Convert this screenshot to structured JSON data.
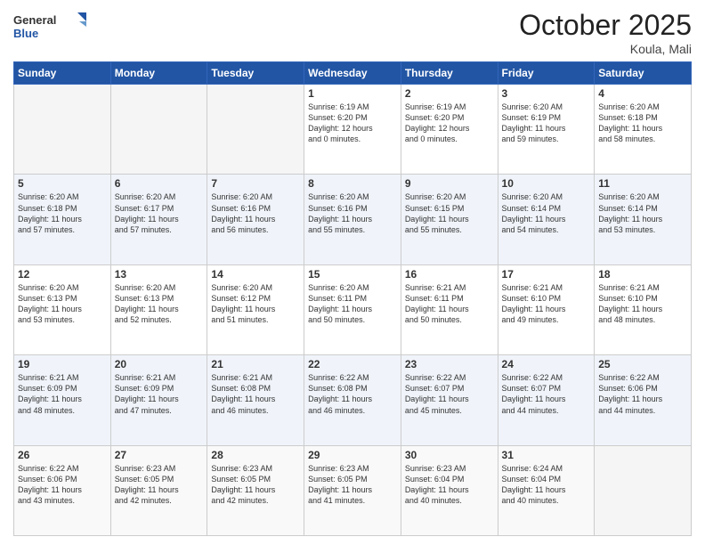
{
  "header": {
    "logo_general": "General",
    "logo_blue": "Blue",
    "month_title": "October 2025",
    "location": "Koula, Mali"
  },
  "days_of_week": [
    "Sunday",
    "Monday",
    "Tuesday",
    "Wednesday",
    "Thursday",
    "Friday",
    "Saturday"
  ],
  "weeks": [
    [
      {
        "day": "",
        "info": ""
      },
      {
        "day": "",
        "info": ""
      },
      {
        "day": "",
        "info": ""
      },
      {
        "day": "1",
        "info": "Sunrise: 6:19 AM\nSunset: 6:20 PM\nDaylight: 12 hours\nand 0 minutes."
      },
      {
        "day": "2",
        "info": "Sunrise: 6:19 AM\nSunset: 6:20 PM\nDaylight: 12 hours\nand 0 minutes."
      },
      {
        "day": "3",
        "info": "Sunrise: 6:20 AM\nSunset: 6:19 PM\nDaylight: 11 hours\nand 59 minutes."
      },
      {
        "day": "4",
        "info": "Sunrise: 6:20 AM\nSunset: 6:18 PM\nDaylight: 11 hours\nand 58 minutes."
      }
    ],
    [
      {
        "day": "5",
        "info": "Sunrise: 6:20 AM\nSunset: 6:18 PM\nDaylight: 11 hours\nand 57 minutes."
      },
      {
        "day": "6",
        "info": "Sunrise: 6:20 AM\nSunset: 6:17 PM\nDaylight: 11 hours\nand 57 minutes."
      },
      {
        "day": "7",
        "info": "Sunrise: 6:20 AM\nSunset: 6:16 PM\nDaylight: 11 hours\nand 56 minutes."
      },
      {
        "day": "8",
        "info": "Sunrise: 6:20 AM\nSunset: 6:16 PM\nDaylight: 11 hours\nand 55 minutes."
      },
      {
        "day": "9",
        "info": "Sunrise: 6:20 AM\nSunset: 6:15 PM\nDaylight: 11 hours\nand 55 minutes."
      },
      {
        "day": "10",
        "info": "Sunrise: 6:20 AM\nSunset: 6:14 PM\nDaylight: 11 hours\nand 54 minutes."
      },
      {
        "day": "11",
        "info": "Sunrise: 6:20 AM\nSunset: 6:14 PM\nDaylight: 11 hours\nand 53 minutes."
      }
    ],
    [
      {
        "day": "12",
        "info": "Sunrise: 6:20 AM\nSunset: 6:13 PM\nDaylight: 11 hours\nand 53 minutes."
      },
      {
        "day": "13",
        "info": "Sunrise: 6:20 AM\nSunset: 6:13 PM\nDaylight: 11 hours\nand 52 minutes."
      },
      {
        "day": "14",
        "info": "Sunrise: 6:20 AM\nSunset: 6:12 PM\nDaylight: 11 hours\nand 51 minutes."
      },
      {
        "day": "15",
        "info": "Sunrise: 6:20 AM\nSunset: 6:11 PM\nDaylight: 11 hours\nand 50 minutes."
      },
      {
        "day": "16",
        "info": "Sunrise: 6:21 AM\nSunset: 6:11 PM\nDaylight: 11 hours\nand 50 minutes."
      },
      {
        "day": "17",
        "info": "Sunrise: 6:21 AM\nSunset: 6:10 PM\nDaylight: 11 hours\nand 49 minutes."
      },
      {
        "day": "18",
        "info": "Sunrise: 6:21 AM\nSunset: 6:10 PM\nDaylight: 11 hours\nand 48 minutes."
      }
    ],
    [
      {
        "day": "19",
        "info": "Sunrise: 6:21 AM\nSunset: 6:09 PM\nDaylight: 11 hours\nand 48 minutes."
      },
      {
        "day": "20",
        "info": "Sunrise: 6:21 AM\nSunset: 6:09 PM\nDaylight: 11 hours\nand 47 minutes."
      },
      {
        "day": "21",
        "info": "Sunrise: 6:21 AM\nSunset: 6:08 PM\nDaylight: 11 hours\nand 46 minutes."
      },
      {
        "day": "22",
        "info": "Sunrise: 6:22 AM\nSunset: 6:08 PM\nDaylight: 11 hours\nand 46 minutes."
      },
      {
        "day": "23",
        "info": "Sunrise: 6:22 AM\nSunset: 6:07 PM\nDaylight: 11 hours\nand 45 minutes."
      },
      {
        "day": "24",
        "info": "Sunrise: 6:22 AM\nSunset: 6:07 PM\nDaylight: 11 hours\nand 44 minutes."
      },
      {
        "day": "25",
        "info": "Sunrise: 6:22 AM\nSunset: 6:06 PM\nDaylight: 11 hours\nand 44 minutes."
      }
    ],
    [
      {
        "day": "26",
        "info": "Sunrise: 6:22 AM\nSunset: 6:06 PM\nDaylight: 11 hours\nand 43 minutes."
      },
      {
        "day": "27",
        "info": "Sunrise: 6:23 AM\nSunset: 6:05 PM\nDaylight: 11 hours\nand 42 minutes."
      },
      {
        "day": "28",
        "info": "Sunrise: 6:23 AM\nSunset: 6:05 PM\nDaylight: 11 hours\nand 42 minutes."
      },
      {
        "day": "29",
        "info": "Sunrise: 6:23 AM\nSunset: 6:05 PM\nDaylight: 11 hours\nand 41 minutes."
      },
      {
        "day": "30",
        "info": "Sunrise: 6:23 AM\nSunset: 6:04 PM\nDaylight: 11 hours\nand 40 minutes."
      },
      {
        "day": "31",
        "info": "Sunrise: 6:24 AM\nSunset: 6:04 PM\nDaylight: 11 hours\nand 40 minutes."
      },
      {
        "day": "",
        "info": ""
      }
    ]
  ]
}
